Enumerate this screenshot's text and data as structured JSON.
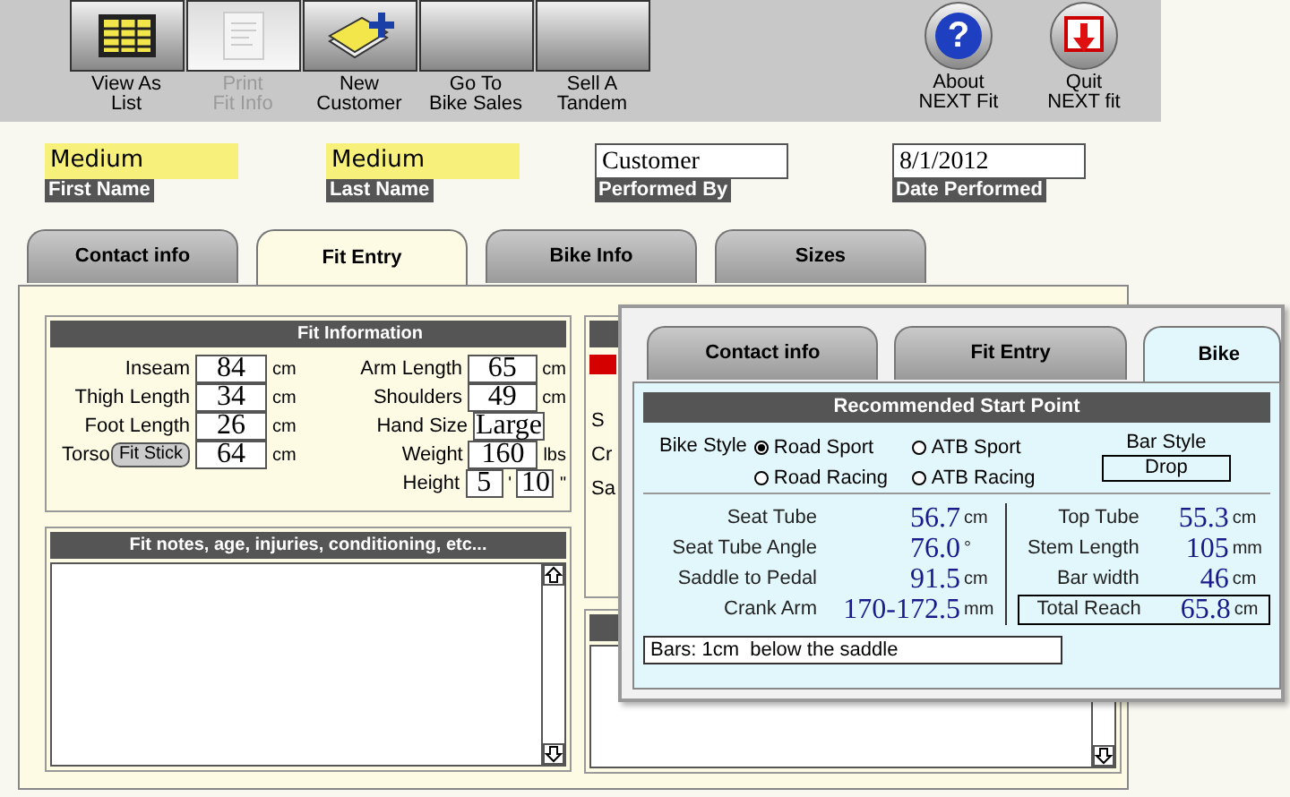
{
  "toolbar": {
    "buttons": [
      {
        "label": "View As\nList",
        "disabled": false
      },
      {
        "label": "Print\nFit Info",
        "disabled": true
      },
      {
        "label": "New\nCustomer",
        "disabled": false
      },
      {
        "label": "Go To\nBike Sales",
        "disabled": false
      },
      {
        "label": "Sell A\nTandem",
        "disabled": false
      }
    ],
    "app_buttons": [
      {
        "label": "About\nNEXT Fit",
        "kind": "help",
        "glyph": "?"
      },
      {
        "label": "Quit\nNEXT fit",
        "kind": "quit"
      }
    ]
  },
  "header_fields": [
    {
      "label": "First Name",
      "value": "Medium",
      "highlighted": true
    },
    {
      "label": "Last Name",
      "value": "Medium",
      "highlighted": true
    },
    {
      "label": "Performed By",
      "value": "Customer",
      "highlighted": false
    },
    {
      "label": "Date Performed",
      "value": "8/1/2012",
      "highlighted": false
    }
  ],
  "tabs": [
    {
      "label": "Contact info",
      "selected": false
    },
    {
      "label": "Fit Entry",
      "selected": true
    },
    {
      "label": "Bike Info",
      "selected": false
    },
    {
      "label": "Sizes",
      "selected": false
    }
  ],
  "fit_information": {
    "title": "Fit Information",
    "left": [
      {
        "kind": "measure",
        "label": "Inseam",
        "value": "84",
        "unit": "cm"
      },
      {
        "kind": "measure",
        "label": "Thigh Length",
        "value": "34",
        "unit": "cm"
      },
      {
        "kind": "measure",
        "label": "Foot Length",
        "value": "26",
        "unit": "cm"
      },
      {
        "kind": "button",
        "label": "Torso",
        "button": "Fit Stick",
        "value": "64",
        "unit": "cm"
      }
    ],
    "right": [
      {
        "kind": "measure",
        "label": "Arm Length",
        "value": "65",
        "unit": "cm"
      },
      {
        "kind": "measure",
        "label": "Shoulders",
        "value": "49",
        "unit": "cm"
      },
      {
        "kind": "measure",
        "label": "Hand Size",
        "value": "Large"
      },
      {
        "kind": "measure",
        "label": "Weight",
        "value": "160",
        "unit": "lbs"
      },
      {
        "kind": "pair",
        "label": "Height",
        "value": "5",
        "unit": "'",
        "value2": "10",
        "unit2": "\""
      }
    ]
  },
  "notes": {
    "title": "Fit notes, age, injuries, conditioning, etc..."
  },
  "side_labels": [
    "S",
    "Cr",
    "Sa"
  ],
  "overlay": {
    "tabs": [
      {
        "label": "Contact info",
        "selected": false
      },
      {
        "label": "Fit Entry",
        "selected": false
      },
      {
        "label": "Bike",
        "selected": true
      }
    ],
    "title": "Recommended Start Point",
    "bike_style": {
      "label": "Bike Style",
      "options": [
        {
          "label": "Road Sport",
          "selected": true
        },
        {
          "label": "ATB Sport",
          "selected": false
        },
        {
          "label": "Road Racing",
          "selected": false
        },
        {
          "label": "ATB Racing",
          "selected": false
        }
      ]
    },
    "bar_style": {
      "label": "Bar Style",
      "value": "Drop"
    },
    "left": [
      {
        "label": "Seat Tube",
        "value": "56.7",
        "unit": "cm",
        "boxed": false
      },
      {
        "label": "Seat Tube Angle",
        "value": "76.0",
        "unit": "°",
        "boxed": false
      },
      {
        "label": "Saddle to Pedal",
        "value": "91.5",
        "unit": "cm",
        "boxed": false
      },
      {
        "label": "Crank Arm",
        "value": "170-172.5",
        "unit": "mm",
        "boxed": false
      }
    ],
    "right": [
      {
        "label": "Top Tube",
        "value": "55.3",
        "unit": "cm",
        "boxed": false
      },
      {
        "label": "Stem Length",
        "value": "105",
        "unit": "mm",
        "boxed": false
      },
      {
        "label": "Bar width",
        "value": "46",
        "unit": "cm",
        "boxed": false
      },
      {
        "label": "Total Reach",
        "value": "65.8",
        "unit": "cm",
        "boxed": true
      }
    ],
    "note": "Bars: 1cm  below the saddle"
  }
}
